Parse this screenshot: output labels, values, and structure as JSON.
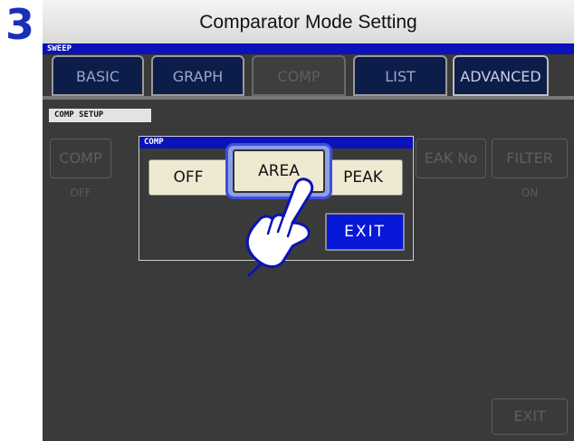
{
  "step_number": "3",
  "page_title": "Comparator Mode Setting",
  "sweep_label": "SWEEP",
  "tabs": [
    {
      "label": "BASIC"
    },
    {
      "label": "GRAPH"
    },
    {
      "label": "COMP"
    },
    {
      "label": "LIST"
    },
    {
      "label": "ADVANCED"
    }
  ],
  "comp_setup_label": "COMP SETUP",
  "background": {
    "comp_button": "COMP",
    "comp_value": "OFF",
    "peak_no_button": "EAK No",
    "filter_button": "FILTER",
    "filter_value": "ON",
    "exit_button": "EXIT"
  },
  "dialog": {
    "title": "COMP",
    "options": [
      "OFF",
      "AREA",
      "PEAK"
    ],
    "selected": "AREA",
    "exit_label": "EXIT"
  },
  "colors": {
    "title_blue": "#0b12b8",
    "tab_dark": "#0d1d4a",
    "option_bg": "#efe9d2",
    "highlight": "#3d4fe0",
    "exit_blue": "#0818d8"
  },
  "icons": [
    "pointing-hand-icon"
  ]
}
